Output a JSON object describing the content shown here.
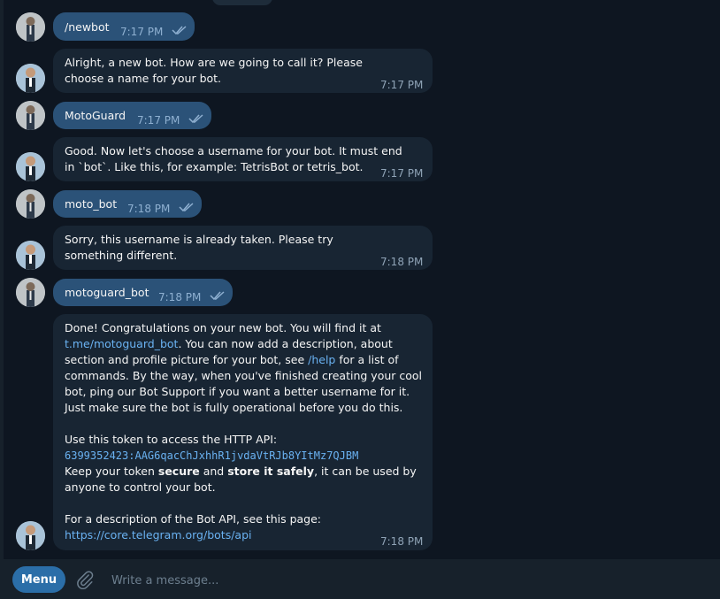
{
  "chat": {
    "messages": [
      {
        "text": "/newbot",
        "time": "7:17 PM",
        "outgoing": true
      },
      {
        "text": "Alright, a new bot. How are we going to call it? Please choose a name for your bot.",
        "time": "7:17 PM",
        "outgoing": false
      },
      {
        "text": "MotoGuard",
        "time": "7:17 PM",
        "outgoing": true
      },
      {
        "text": "Good. Now let's choose a username for your bot. It must end in `bot`. Like this, for example: TetrisBot or tetris_bot.",
        "time": "7:17 PM",
        "outgoing": false
      },
      {
        "text": "moto_bot",
        "time": "7:18 PM",
        "outgoing": true
      },
      {
        "text": "Sorry, this username is already taken. Please try something different.",
        "time": "7:18 PM",
        "outgoing": false
      },
      {
        "text": "motoguard_bot",
        "time": "7:18 PM",
        "outgoing": true
      }
    ],
    "final": {
      "p1_a": "Done! Congratulations on your new bot. You will find it at ",
      "p1_link": "t.me/motoguard_bot",
      "p1_b": ". You can now add a description, about section and profile picture for your bot, see ",
      "p1_help": "/help",
      "p1_c": " for a list of commands. By the way, when you've finished creating your cool bot, ping our Bot Support if you want a better username for it. Just make sure the bot is fully operational before you do this.",
      "p2_label": "Use this token to access the HTTP API:",
      "token": "6399352423:AAG6qacChJxhhR1jvdaVtRJb8YItMz7QJBM",
      "p3_a": "Keep your token ",
      "p3_secure": "secure",
      "p3_b": " and ",
      "p3_store": "store it safely",
      "p3_c": ", it can be used by anyone to control your bot.",
      "p4_label": "For a description of the Bot API, see this page:",
      "p4_link": "https://core.telegram.org/bots/api",
      "time": "7:18 PM"
    }
  },
  "composer": {
    "menu_label": "Menu",
    "placeholder": "Write a message..."
  },
  "colors": {
    "background": "#0e1621",
    "outgoing_bubble": "#2b5278",
    "incoming_bubble": "#182533",
    "accent": "#2b6ea8",
    "link": "#6ab2f2"
  },
  "icons": [
    "user-avatar-icon",
    "bot-avatar-icon",
    "double-check-icon",
    "paperclip-icon"
  ]
}
